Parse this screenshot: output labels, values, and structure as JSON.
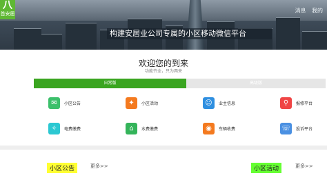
{
  "brand": {
    "logo_glyph": "八",
    "logo_text": "首安居"
  },
  "header": {
    "links": [
      "消息",
      "我的"
    ],
    "title": "构建安居业公司专属的小区移动微信平台"
  },
  "welcome": {
    "title": "欢迎您的到来",
    "subtitle": "功能齐全，只为两来"
  },
  "tabs": [
    {
      "label": "日常版",
      "active": true
    },
    {
      "label": "高级版",
      "active": false
    }
  ],
  "services": [
    {
      "label": "小区公告",
      "icon": "chat-bubble-icon",
      "color": "#3cc06b",
      "glyph": "✉"
    },
    {
      "label": "小区活动",
      "icon": "megaphone-icon",
      "color": "#f47a1f",
      "glyph": "✦"
    },
    {
      "label": "业主信息",
      "icon": "person-icon",
      "color": "#2f8fe0",
      "glyph": "☺"
    },
    {
      "label": "报修平台",
      "icon": "search-icon",
      "color": "#f04545",
      "glyph": "⚲"
    },
    {
      "label": "电费缴费",
      "icon": "lightbulb-icon",
      "color": "#2cc8d2",
      "glyph": "✧"
    },
    {
      "label": "水费缴费",
      "icon": "home-icon",
      "color": "#34b45a",
      "glyph": "⌂"
    },
    {
      "label": "车辆收费",
      "icon": "car-icon",
      "color": "#f47a1f",
      "glyph": "◉"
    },
    {
      "label": "投诉平台",
      "icon": "phone-icon",
      "color": "#4a90e2",
      "glyph": "☏"
    }
  ],
  "sections": {
    "notice": {
      "title": "小区公告",
      "more": "更多>>",
      "color": "#ffff33"
    },
    "activity": {
      "title": "小区活动",
      "more": "更多>>",
      "color": "#66ff33"
    }
  }
}
